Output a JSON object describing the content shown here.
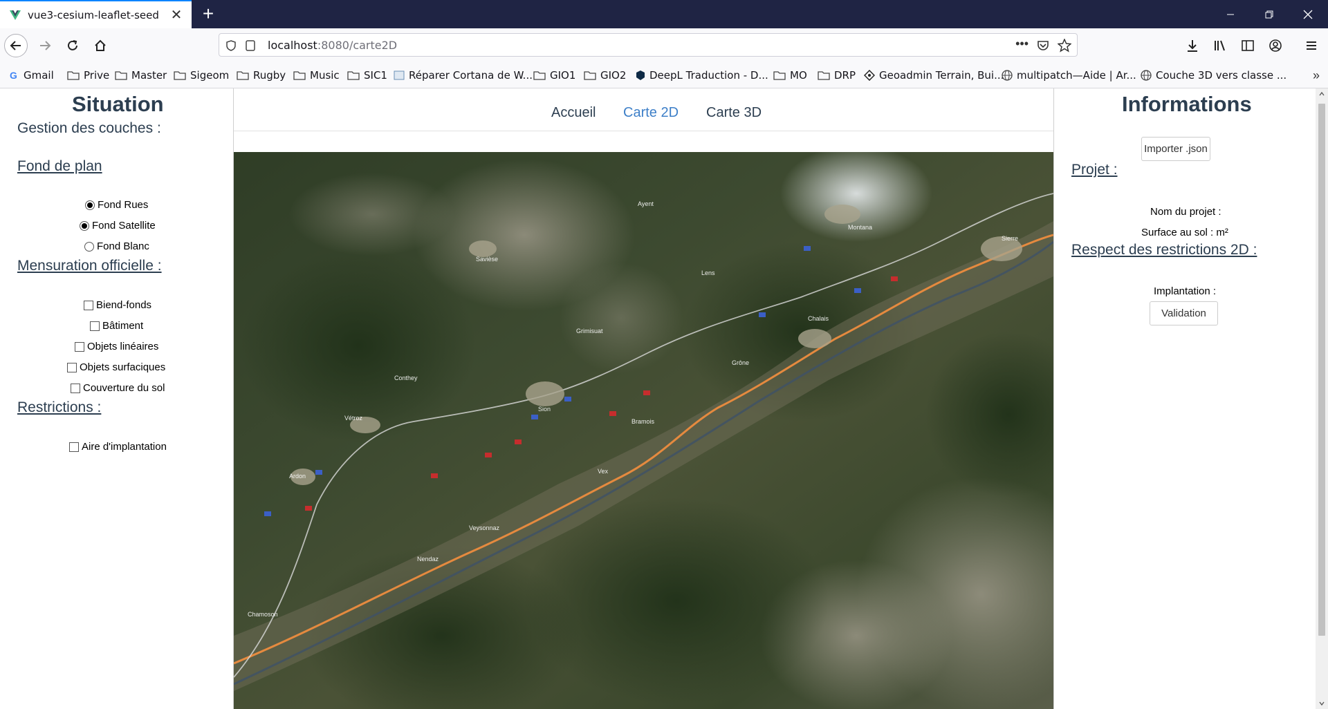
{
  "browser": {
    "tab_title": "vue3-cesium-leaflet-seed",
    "url_host": "localhost",
    "url_path": ":8080/carte2D",
    "bookmarks": [
      {
        "label": "Gmail",
        "icon": "google-icon"
      },
      {
        "label": "Prive",
        "icon": "folder-icon"
      },
      {
        "label": "Master",
        "icon": "folder-icon"
      },
      {
        "label": "Sigeom",
        "icon": "folder-icon"
      },
      {
        "label": "Rugby",
        "icon": "folder-icon"
      },
      {
        "label": "Music",
        "icon": "folder-icon"
      },
      {
        "label": "SIC1",
        "icon": "folder-icon"
      },
      {
        "label": "Réparer Cortana de W...",
        "icon": "page-icon"
      },
      {
        "label": "GIO1",
        "icon": "folder-icon"
      },
      {
        "label": "GIO2",
        "icon": "folder-icon"
      },
      {
        "label": "DeepL Traduction - D...",
        "icon": "deepl-icon"
      },
      {
        "label": "MO",
        "icon": "folder-icon"
      },
      {
        "label": "DRP",
        "icon": "folder-icon"
      },
      {
        "label": "Geoadmin Terrain, Bui...",
        "icon": "geoadmin-icon"
      },
      {
        "label": "multipatch—Aide | Ar...",
        "icon": "globe-icon"
      },
      {
        "label": "Couche 3D vers classe ...",
        "icon": "globe-icon"
      }
    ]
  },
  "left": {
    "title": "Situation",
    "subtitle": "Gestion des couches :",
    "basemap_heading": "Fond de plan",
    "basemaps": [
      {
        "label": "Fond Rues",
        "checked": true
      },
      {
        "label": "Fond Satellite",
        "checked": true
      },
      {
        "label": "Fond Blanc",
        "checked": false
      }
    ],
    "cadastre_heading": "Mensuration officielle :",
    "cadastre_layers": [
      "Biend-fonds",
      "Bâtiment",
      "Objets linéaires",
      "Objets surfaciques",
      "Couverture du sol"
    ],
    "restrictions_heading": "Restrictions :",
    "restriction_layers": [
      "Aire d'implantation"
    ]
  },
  "nav": {
    "links": [
      "Accueil",
      "Carte 2D",
      "Carte 3D"
    ],
    "active": "Carte 2D"
  },
  "map": {
    "labels": [
      "Sion",
      "Vétroz",
      "Ardon",
      "Grimisuat",
      "Grône",
      "Chalais",
      "Sierre",
      "Nendaz",
      "Ayent",
      "Lens",
      "Montana",
      "Bramois",
      "Savièse",
      "Conthey",
      "Vex",
      "Veysonnaz",
      "Chamoson"
    ]
  },
  "right": {
    "title": "Informations",
    "import_button": "Importer .json",
    "project_heading": "Projet :",
    "project_name_label": "Nom du projet :",
    "surface_label": "Surface au sol : m²",
    "restrictions_heading": "Respect des restrictions 2D :",
    "implantation_label": "Implantation :",
    "validation_button": "Validation"
  }
}
